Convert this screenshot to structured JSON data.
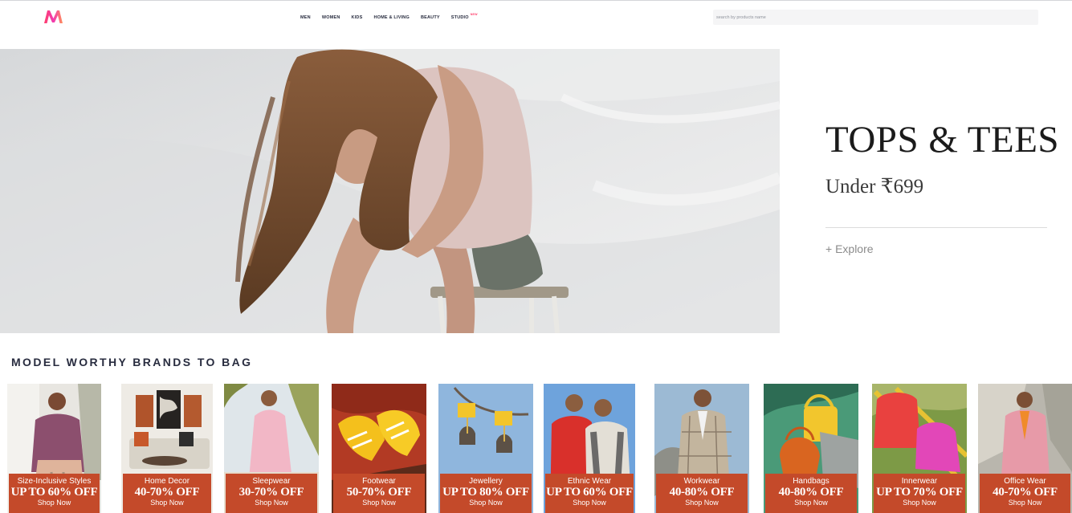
{
  "header": {
    "logo_icon": "myntra-logo-icon",
    "nav": [
      {
        "label": "MEN"
      },
      {
        "label": "WOMEN"
      },
      {
        "label": "KIDS"
      },
      {
        "label": "HOME & LIVING"
      },
      {
        "label": "BEAUTY"
      },
      {
        "label": "STUDIO",
        "badge": "NEW"
      }
    ],
    "search_placeholder": "search by products name"
  },
  "hero": {
    "title": "TOPS & TEES",
    "subtitle": "Under ₹699",
    "cta": "+ Explore"
  },
  "section": {
    "title": "MODEL WORTHY BRANDS TO BAG"
  },
  "brand_cards": [
    {
      "category": "Size-Inclusive Styles",
      "offer": "UP TO 60% OFF",
      "cta": "Shop Now"
    },
    {
      "category": "Home Decor",
      "offer": "40-70% OFF",
      "cta": "Shop Now"
    },
    {
      "category": "Sleepwear",
      "offer": "30-70% OFF",
      "cta": "Shop Now"
    },
    {
      "category": "Footwear",
      "offer": "50-70% OFF",
      "cta": "Shop Now"
    },
    {
      "category": "Jewellery",
      "offer": "UP TO 80% OFF",
      "cta": "Shop Now"
    },
    {
      "category": "Ethnic Wear",
      "offer": "UP TO 60% OFF",
      "cta": "Shop Now"
    },
    {
      "category": "Workwear",
      "offer": "40-80% OFF",
      "cta": "Shop Now"
    },
    {
      "category": "Handbags",
      "offer": "40-80% OFF",
      "cta": "Shop Now"
    },
    {
      "category": "Innerwear",
      "offer": "UP TO 70% OFF",
      "cta": "Shop Now"
    },
    {
      "category": "Office Wear",
      "offer": "40-70% OFF",
      "cta": "Shop Now"
    }
  ],
  "colors": {
    "brand_pink": "#ff3f6c",
    "brand_orange": "#f13ab1",
    "card_label": "#c44a2a",
    "text_dark": "#282c3f"
  }
}
